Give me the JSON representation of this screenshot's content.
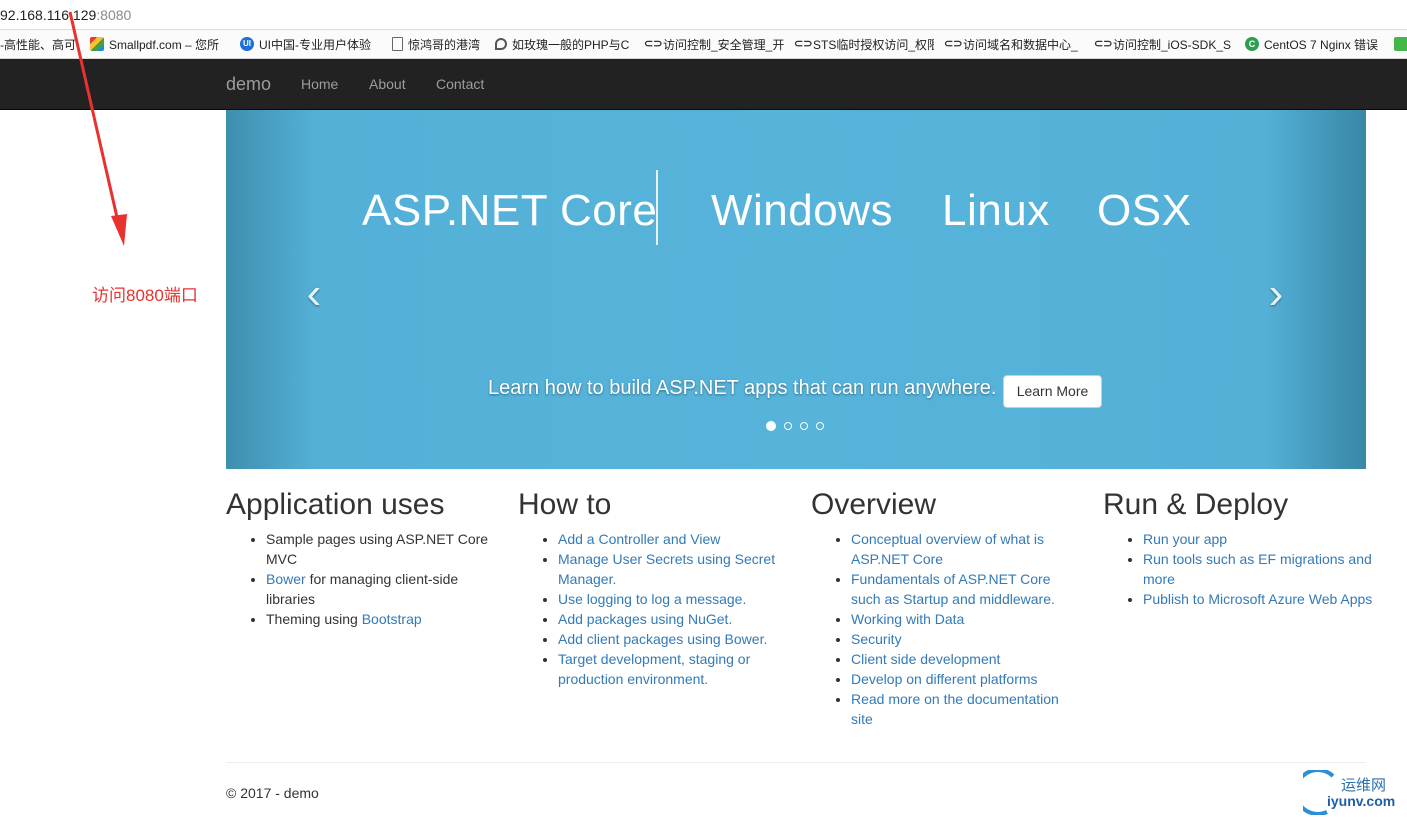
{
  "browser": {
    "url_host": "92.168.116.129",
    "url_port": ":8080",
    "bookmarks": [
      {
        "label": "-高性能、高可",
        "icon": "none"
      },
      {
        "label": "Smallpdf.com – 您所",
        "icon": "smallpdf-icon"
      },
      {
        "label": "UI中国-专业用户体验",
        "icon": "ui-china-icon"
      },
      {
        "label": "惊鸿哥的港湾",
        "icon": "document-icon"
      },
      {
        "label": "如玫瑰一般的PHP与C",
        "icon": "rose-icon"
      },
      {
        "label": "访问控制_安全管理_开",
        "icon": "link-icon"
      },
      {
        "label": "STS临时授权访问_权限",
        "icon": "link-icon"
      },
      {
        "label": "访问域名和数据中心_",
        "icon": "link-icon"
      },
      {
        "label": "访问控制_iOS-SDK_S",
        "icon": "link-icon"
      },
      {
        "label": "CentOS 7 Nginx 错误",
        "icon": "c-icon"
      }
    ]
  },
  "navbar": {
    "brand": "demo",
    "links": [
      "Home",
      "About",
      "Contact"
    ]
  },
  "carousel": {
    "hero": [
      "ASP.NET Core",
      "Windows",
      "Linux",
      "OSX"
    ],
    "prev_glyph": "‹",
    "next_glyph": "›",
    "caption": "Learn how to build ASP.NET apps that can run anywhere.",
    "button_label": "Learn More",
    "active_slide": 1,
    "slide_count": 4
  },
  "columns": [
    {
      "title": "Application uses",
      "items": [
        {
          "parts": [
            {
              "text": "Sample pages using ASP.NET Core MVC",
              "link": false
            }
          ]
        },
        {
          "parts": [
            {
              "text": "Bower",
              "link": true
            },
            {
              "text": " for managing client-side libraries",
              "link": false
            }
          ]
        },
        {
          "parts": [
            {
              "text": "Theming using ",
              "link": false
            },
            {
              "text": "Bootstrap",
              "link": true
            }
          ]
        }
      ]
    },
    {
      "title": "How to",
      "items": [
        {
          "parts": [
            {
              "text": "Add a Controller and View",
              "link": true
            }
          ]
        },
        {
          "parts": [
            {
              "text": "Manage User Secrets using Secret Manager.",
              "link": true
            }
          ]
        },
        {
          "parts": [
            {
              "text": "Use logging to log a message.",
              "link": true
            }
          ]
        },
        {
          "parts": [
            {
              "text": "Add packages using NuGet.",
              "link": true
            }
          ]
        },
        {
          "parts": [
            {
              "text": "Add client packages using Bower.",
              "link": true
            }
          ]
        },
        {
          "parts": [
            {
              "text": "Target development, staging or production environment.",
              "link": true
            }
          ]
        }
      ]
    },
    {
      "title": "Overview",
      "items": [
        {
          "parts": [
            {
              "text": "Conceptual overview of what is ASP.NET Core",
              "link": true
            }
          ]
        },
        {
          "parts": [
            {
              "text": "Fundamentals of ASP.NET Core such as Startup and middleware.",
              "link": true
            }
          ]
        },
        {
          "parts": [
            {
              "text": "Working with Data",
              "link": true
            }
          ]
        },
        {
          "parts": [
            {
              "text": "Security",
              "link": true
            }
          ]
        },
        {
          "parts": [
            {
              "text": "Client side development",
              "link": true
            }
          ]
        },
        {
          "parts": [
            {
              "text": "Develop on different platforms",
              "link": true
            }
          ]
        },
        {
          "parts": [
            {
              "text": "Read more on the documentation site",
              "link": true
            }
          ]
        }
      ]
    },
    {
      "title": "Run & Deploy",
      "items": [
        {
          "parts": [
            {
              "text": "Run your app",
              "link": true
            }
          ]
        },
        {
          "parts": [
            {
              "text": "Run tools such as EF migrations and more",
              "link": true
            }
          ]
        },
        {
          "parts": [
            {
              "text": "Publish to Microsoft Azure Web Apps",
              "link": true
            }
          ]
        }
      ]
    }
  ],
  "footer": "© 2017 - demo",
  "annotation": {
    "text": "访问8080端口",
    "color": "#e8322f"
  },
  "watermark": {
    "line1": "运维网",
    "line2": "iyunv.com"
  },
  "colors": {
    "navbar": "#222222",
    "carousel": "#56b3da",
    "link": "#337ab7"
  }
}
